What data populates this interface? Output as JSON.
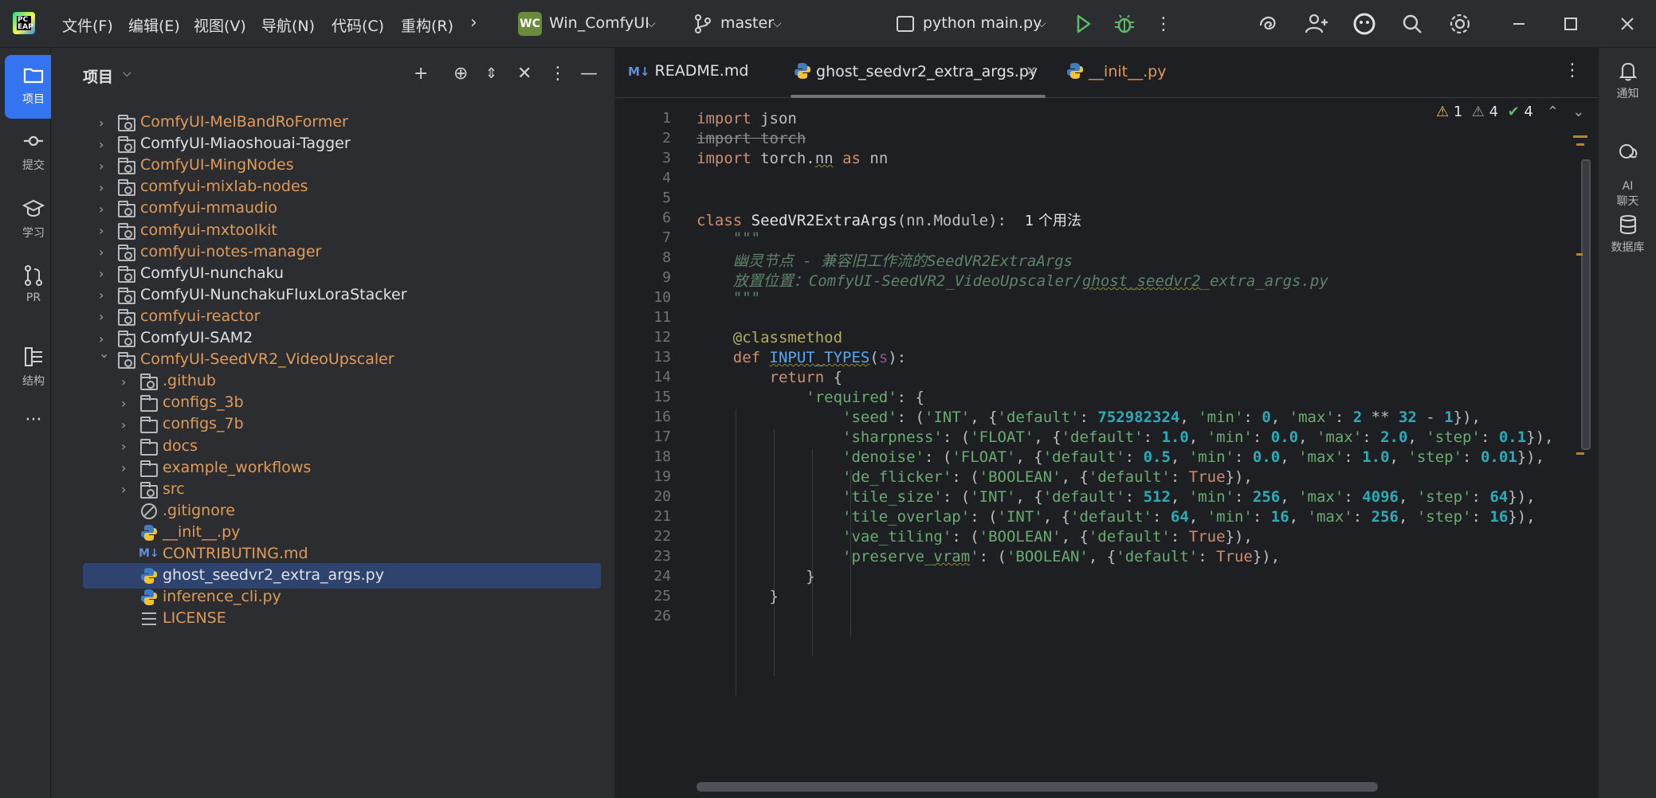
{
  "titlebar": {
    "logo_text": "PC\nEAP",
    "menus": [
      "文件(F)",
      "编辑(E)",
      "视图(V)",
      "导航(N)",
      "代码(C)",
      "重构(R)"
    ],
    "project_badge": "WC",
    "project_name": "Win_ComfyUI",
    "branch": "master",
    "run_config": "python main.py"
  },
  "leftstrip": {
    "items": [
      {
        "label": "项目",
        "icon": "folder-icon"
      },
      {
        "label": "提交",
        "icon": "commit-icon"
      },
      {
        "label": "学习",
        "icon": "learn-icon"
      },
      {
        "label": "PR",
        "icon": "pull-request-icon"
      },
      {
        "label": "结构",
        "icon": "structure-icon"
      },
      {
        "label": "···",
        "icon": "more-icon"
      }
    ]
  },
  "project_panel": {
    "title": "项目",
    "tree": [
      {
        "label": "ComfyUI-MelBandRoFormer",
        "type": "module",
        "level": 0,
        "expanded": false,
        "color": "orange"
      },
      {
        "label": "ComfyUI-Miaoshouai-Tagger",
        "type": "module",
        "level": 0,
        "expanded": false,
        "color": "white"
      },
      {
        "label": "ComfyUI-MingNodes",
        "type": "module",
        "level": 0,
        "expanded": false,
        "color": "orange"
      },
      {
        "label": "comfyui-mixlab-nodes",
        "type": "module",
        "level": 0,
        "expanded": false,
        "color": "orange"
      },
      {
        "label": "comfyui-mmaudio",
        "type": "module",
        "level": 0,
        "expanded": false,
        "color": "orange"
      },
      {
        "label": "comfyui-mxtoolkit",
        "type": "module",
        "level": 0,
        "expanded": false,
        "color": "orange"
      },
      {
        "label": "comfyui-notes-manager",
        "type": "module",
        "level": 0,
        "expanded": false,
        "color": "orange"
      },
      {
        "label": "ComfyUI-nunchaku",
        "type": "module",
        "level": 0,
        "expanded": false,
        "color": "white"
      },
      {
        "label": "ComfyUI-NunchakuFluxLoraStacker",
        "type": "module",
        "level": 0,
        "expanded": false,
        "color": "white"
      },
      {
        "label": "comfyui-reactor",
        "type": "module",
        "level": 0,
        "expanded": false,
        "color": "orange"
      },
      {
        "label": "ComfyUI-SAM2",
        "type": "module",
        "level": 0,
        "expanded": false,
        "color": "white"
      },
      {
        "label": "ComfyUI-SeedVR2_VideoUpscaler",
        "type": "module",
        "level": 0,
        "expanded": true,
        "color": "orange"
      },
      {
        "label": ".github",
        "type": "module",
        "level": 1,
        "expanded": false,
        "color": "orange"
      },
      {
        "label": "configs_3b",
        "type": "folder",
        "level": 1,
        "expanded": false,
        "color": "orange"
      },
      {
        "label": "configs_7b",
        "type": "folder",
        "level": 1,
        "expanded": false,
        "color": "orange"
      },
      {
        "label": "docs",
        "type": "folder",
        "level": 1,
        "expanded": false,
        "color": "orange"
      },
      {
        "label": "example_workflows",
        "type": "folder",
        "level": 1,
        "expanded": false,
        "color": "orange"
      },
      {
        "label": "src",
        "type": "module",
        "level": 1,
        "expanded": false,
        "color": "orange"
      },
      {
        "label": ".gitignore",
        "type": "ignore",
        "level": 1,
        "color": "orange"
      },
      {
        "label": "__init__.py",
        "type": "python",
        "level": 1,
        "color": "orange"
      },
      {
        "label": "CONTRIBUTING.md",
        "type": "markdown",
        "level": 1,
        "color": "orange"
      },
      {
        "label": "ghost_seedvr2_extra_args.py",
        "type": "python",
        "level": 1,
        "color": "white",
        "selected": true
      },
      {
        "label": "inference_cli.py",
        "type": "python",
        "level": 1,
        "color": "orange"
      },
      {
        "label": "LICENSE",
        "type": "license",
        "level": 1,
        "color": "orange"
      }
    ]
  },
  "editor": {
    "tabs": [
      {
        "label": "README.md",
        "prefix": "M↓"
      },
      {
        "label": "ghost_seedvr2_extra_args.py",
        "active": true
      },
      {
        "label": "__init__.py"
      }
    ],
    "inspections": {
      "warnings_a": "1",
      "warnings_b": "4",
      "ok": "4"
    },
    "usage_hint": "1 个用法",
    "line_numbers": [
      "1",
      "2",
      "3",
      "4",
      "5",
      "6",
      "7",
      "8",
      "9",
      "10",
      "11",
      "12",
      "13",
      "14",
      "15",
      "16",
      "17",
      "18",
      "19",
      "20",
      "21",
      "22",
      "23",
      "24",
      "25",
      "26"
    ]
  },
  "rightstrip": {
    "items": [
      {
        "label": "通知",
        "icon": "bell-icon"
      },
      {
        "label": "AI\n聊天",
        "icon": "ai-chat-icon"
      },
      {
        "label": "数据库",
        "icon": "database-icon"
      }
    ]
  },
  "colors": {
    "accent": "#3574f0",
    "keyword": "#cf8e6d",
    "string": "#6aab73",
    "number": "#2aacb8",
    "docstring": "#5f826b",
    "orange_file": "#e09b5a"
  }
}
